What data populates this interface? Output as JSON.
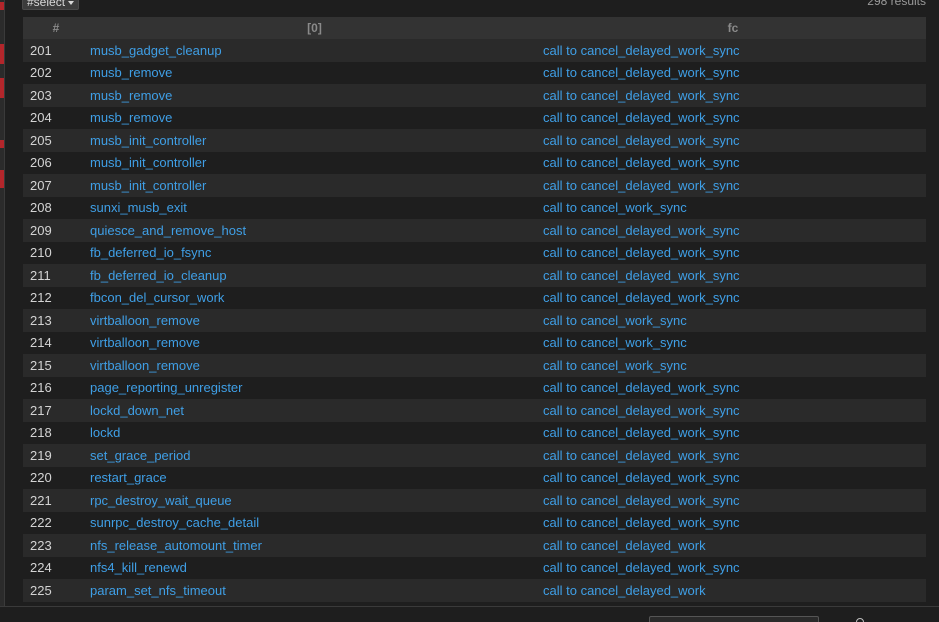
{
  "toolbar": {
    "select_label": "#select",
    "results_label": "298 results"
  },
  "table": {
    "headers": [
      "#",
      "[0]",
      "fc"
    ],
    "rows": [
      {
        "num": "201",
        "fn": "musb_gadget_cleanup",
        "fc": "call to cancel_delayed_work_sync"
      },
      {
        "num": "202",
        "fn": "musb_remove",
        "fc": "call to cancel_delayed_work_sync"
      },
      {
        "num": "203",
        "fn": "musb_remove",
        "fc": "call to cancel_delayed_work_sync"
      },
      {
        "num": "204",
        "fn": "musb_remove",
        "fc": "call to cancel_delayed_work_sync"
      },
      {
        "num": "205",
        "fn": "musb_init_controller",
        "fc": "call to cancel_delayed_work_sync"
      },
      {
        "num": "206",
        "fn": "musb_init_controller",
        "fc": "call to cancel_delayed_work_sync"
      },
      {
        "num": "207",
        "fn": "musb_init_controller",
        "fc": "call to cancel_delayed_work_sync"
      },
      {
        "num": "208",
        "fn": "sunxi_musb_exit",
        "fc": "call to cancel_work_sync"
      },
      {
        "num": "209",
        "fn": "quiesce_and_remove_host",
        "fc": "call to cancel_delayed_work_sync"
      },
      {
        "num": "210",
        "fn": "fb_deferred_io_fsync",
        "fc": "call to cancel_delayed_work_sync"
      },
      {
        "num": "211",
        "fn": "fb_deferred_io_cleanup",
        "fc": "call to cancel_delayed_work_sync"
      },
      {
        "num": "212",
        "fn": "fbcon_del_cursor_work",
        "fc": "call to cancel_delayed_work_sync"
      },
      {
        "num": "213",
        "fn": "virtballoon_remove",
        "fc": "call to cancel_work_sync"
      },
      {
        "num": "214",
        "fn": "virtballoon_remove",
        "fc": "call to cancel_work_sync"
      },
      {
        "num": "215",
        "fn": "virtballoon_remove",
        "fc": "call to cancel_work_sync"
      },
      {
        "num": "216",
        "fn": "page_reporting_unregister",
        "fc": "call to cancel_delayed_work_sync"
      },
      {
        "num": "217",
        "fn": "lockd_down_net",
        "fc": "call to cancel_delayed_work_sync"
      },
      {
        "num": "218",
        "fn": "lockd",
        "fc": "call to cancel_delayed_work_sync"
      },
      {
        "num": "219",
        "fn": "set_grace_period",
        "fc": "call to cancel_delayed_work_sync"
      },
      {
        "num": "220",
        "fn": "restart_grace",
        "fc": "call to cancel_delayed_work_sync"
      },
      {
        "num": "221",
        "fn": "rpc_destroy_wait_queue",
        "fc": "call to cancel_delayed_work_sync"
      },
      {
        "num": "222",
        "fn": "sunrpc_destroy_cache_detail",
        "fc": "call to cancel_delayed_work_sync"
      },
      {
        "num": "223",
        "fn": "nfs_release_automount_timer",
        "fc": "call to cancel_delayed_work"
      },
      {
        "num": "224",
        "fn": "nfs4_kill_renewd",
        "fc": "call to cancel_delayed_work_sync"
      },
      {
        "num": "225",
        "fn": "param_set_nfs_timeout",
        "fc": "call to cancel_delayed_work"
      }
    ]
  },
  "colors": {
    "link": "#3f9fe6",
    "background": "#1e1e1e",
    "row_alt": "#2a2a2a",
    "header_bg": "#333333",
    "accent_red": "#b3262b"
  }
}
